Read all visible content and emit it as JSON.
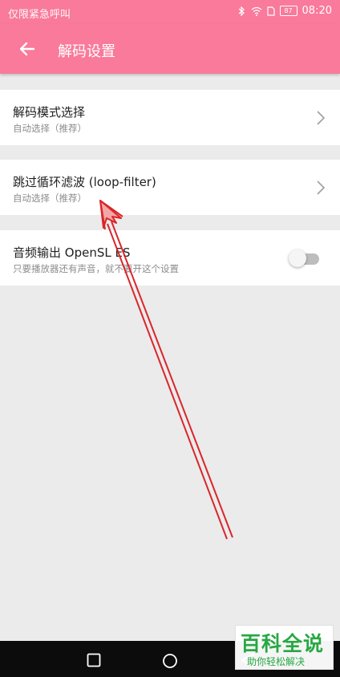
{
  "statusbar": {
    "carrier": "仅限紧急呼叫",
    "battery": "87",
    "time": "08:20"
  },
  "appbar": {
    "title": "解码设置",
    "back_icon": "arrow-left-icon"
  },
  "settings": [
    {
      "title": "解码模式选择",
      "summary": "自动选择（推荐）",
      "control": "chevron-right-icon"
    },
    {
      "title": "跳过循环滤波 (loop-filter)",
      "summary": "自动选择（推荐）",
      "control": "chevron-right-icon"
    },
    {
      "title": "音频输出 OpenSL ES",
      "summary": "只要播放器还有声音，就不要开这个设置",
      "control": "toggle",
      "enabled": false
    }
  ],
  "navbar": {
    "icons": [
      "square-icon",
      "circle-icon",
      "triangle-icon"
    ]
  },
  "watermark": {
    "main": "百科全说",
    "sub": "助你轻松解决"
  },
  "colors": {
    "accent": "#f97a9a",
    "background": "#ebebeb",
    "annotation": "#d9262b",
    "watermark": "#27a843"
  }
}
